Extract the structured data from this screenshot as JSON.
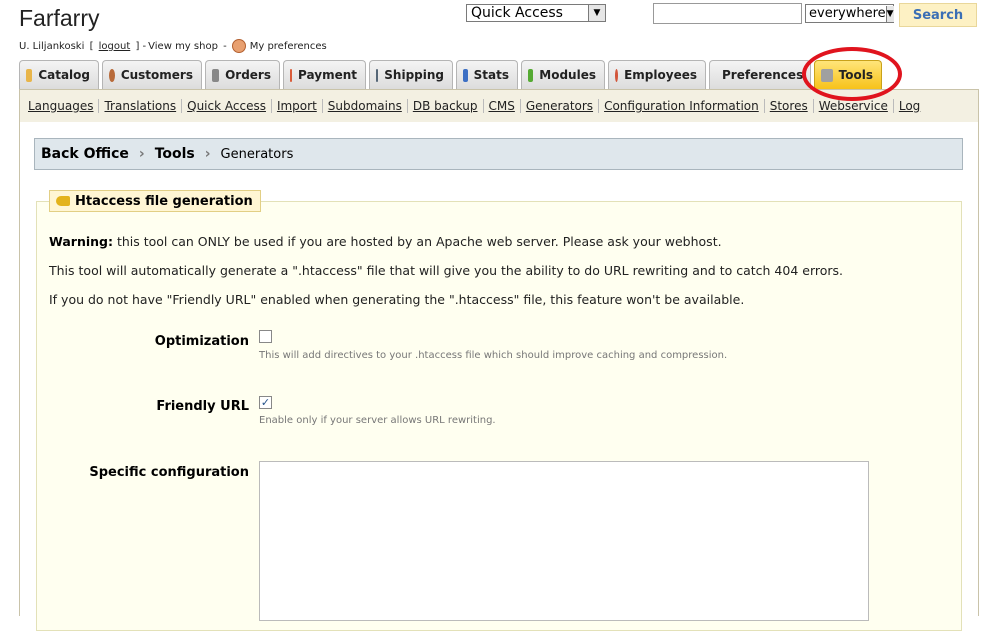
{
  "header": {
    "shop_name": "Farfarry",
    "user": "U. Liljankoski",
    "logout": "logout",
    "view_shop": "View my shop",
    "preferences": "My preferences",
    "quick_access": "Quick Access",
    "search_scope": "everywhere",
    "search_value": "",
    "search_button": "Search"
  },
  "tabs": [
    {
      "label": "Catalog",
      "icon": "folder-icon",
      "color": "#e8b54a"
    },
    {
      "label": "Customers",
      "icon": "customer-icon",
      "color": "#b86a3a"
    },
    {
      "label": "Orders",
      "icon": "cart-icon",
      "color": "#888888"
    },
    {
      "label": "Payment",
      "icon": "payment-icon",
      "color": "#d95c3a"
    },
    {
      "label": "Shipping",
      "icon": "truck-icon",
      "color": "#556677"
    },
    {
      "label": "Stats",
      "icon": "stats-icon",
      "color": "#3c6fc4"
    },
    {
      "label": "Modules",
      "icon": "puzzle-icon",
      "color": "#55aa33"
    },
    {
      "label": "Employees",
      "icon": "employee-icon",
      "color": "#d2553a"
    },
    {
      "label": "Preferences",
      "icon": "preferences-icon",
      "color": "#7a9ec8"
    },
    {
      "label": "Tools",
      "icon": "wrench-icon",
      "color": "#a0a0a0"
    }
  ],
  "subnav": [
    "Languages",
    "Translations",
    "Quick Access",
    "Import",
    "Subdomains",
    "DB backup",
    "CMS",
    "Generators",
    "Configuration Information",
    "Stores",
    "Webservice",
    "Log"
  ],
  "breadcrumb": {
    "root": "Back Office",
    "section": "Tools",
    "current": "Generators"
  },
  "panel": {
    "title": "Htaccess file generation",
    "warning_label": "Warning:",
    "warning_text": " this tool can ONLY be used if you are hosted by an Apache web server. Please ask your webhost.",
    "line2": "This tool will automatically generate a \".htaccess\" file that will give you the ability to do URL rewriting and to catch 404 errors.",
    "line3": "If you do not have \"Friendly URL\" enabled when generating the \".htaccess\" file, this feature won't be available.",
    "optimization_label": "Optimization",
    "optimization_help": "This will add directives to your .htaccess file which should improve caching and compression.",
    "friendly_label": "Friendly URL",
    "friendly_help": "Enable only if your server allows URL rewriting.",
    "specific_label": "Specific configuration"
  }
}
